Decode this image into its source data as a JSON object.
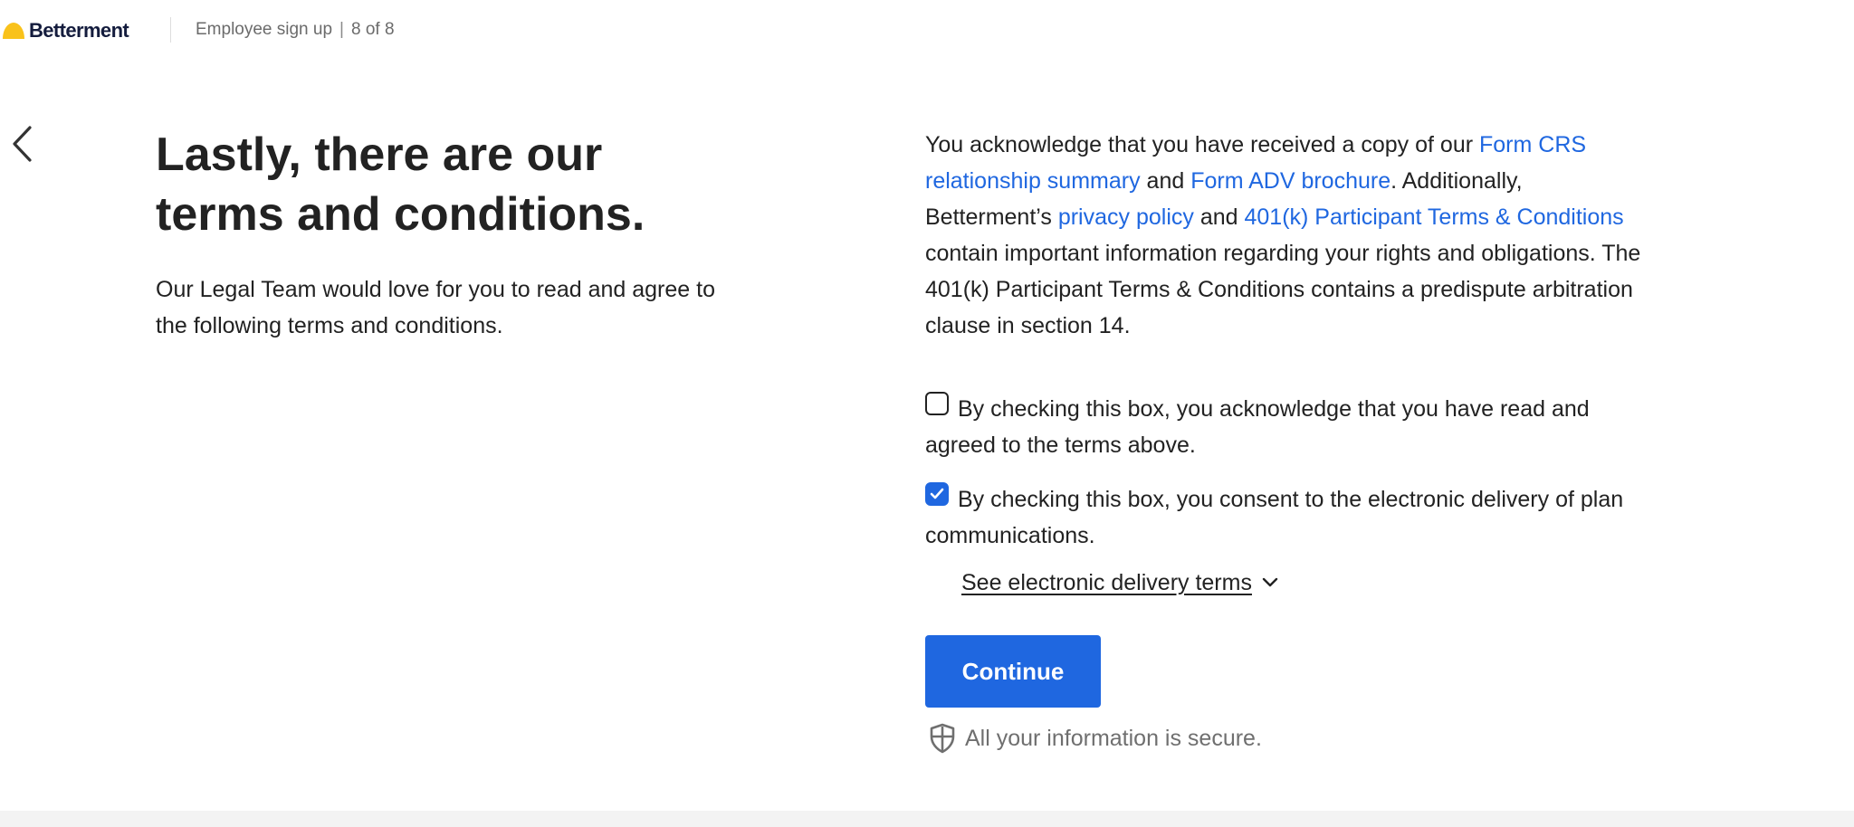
{
  "header": {
    "brand": "Betterment",
    "flow_label": "Employee sign up",
    "separator": "|",
    "step": "8 of 8"
  },
  "left": {
    "title": "Lastly, there are our terms and conditions.",
    "intro": "Our Legal Team would love for you to read and agree to the following terms and conditions."
  },
  "disclosure": {
    "text_1": "You acknowledge that you have received a copy of our ",
    "link_form_crs": "Form CRS relationship summary",
    "text_2": " and ",
    "link_form_adv": "Form ADV brochure",
    "text_3": ". Additionally, Betterment’s ",
    "link_privacy": "privacy policy",
    "text_4": " and ",
    "link_401k_terms": "401(k) Participant Terms & Conditions",
    "text_5": " contain important information regarding your rights and obligations. The 401(k) Participant Terms & Conditions contains a predispute arbitration clause in section 14."
  },
  "checkboxes": [
    {
      "label": "By checking this box, you acknowledge that you have read and agreed to the terms above.",
      "checked": false
    },
    {
      "label": "By checking this box, you consent to the electronic delivery of plan communications.",
      "checked": true
    }
  ],
  "delivery_terms_link": "See electronic delivery terms",
  "continue_label": "Continue",
  "secure_note": "All your information is secure.",
  "icons": {
    "logo": "betterment-logo-icon",
    "back": "chevron-left-icon",
    "checkmark": "checkmark-icon",
    "dropdown": "chevron-down-icon",
    "shield": "shield-icon"
  },
  "colors": {
    "accent": "#1f67e0",
    "brand_yellow": "#f9c21b",
    "brand_navy": "#141c3d",
    "text": "#222222",
    "muted": "#6f6f6f"
  }
}
